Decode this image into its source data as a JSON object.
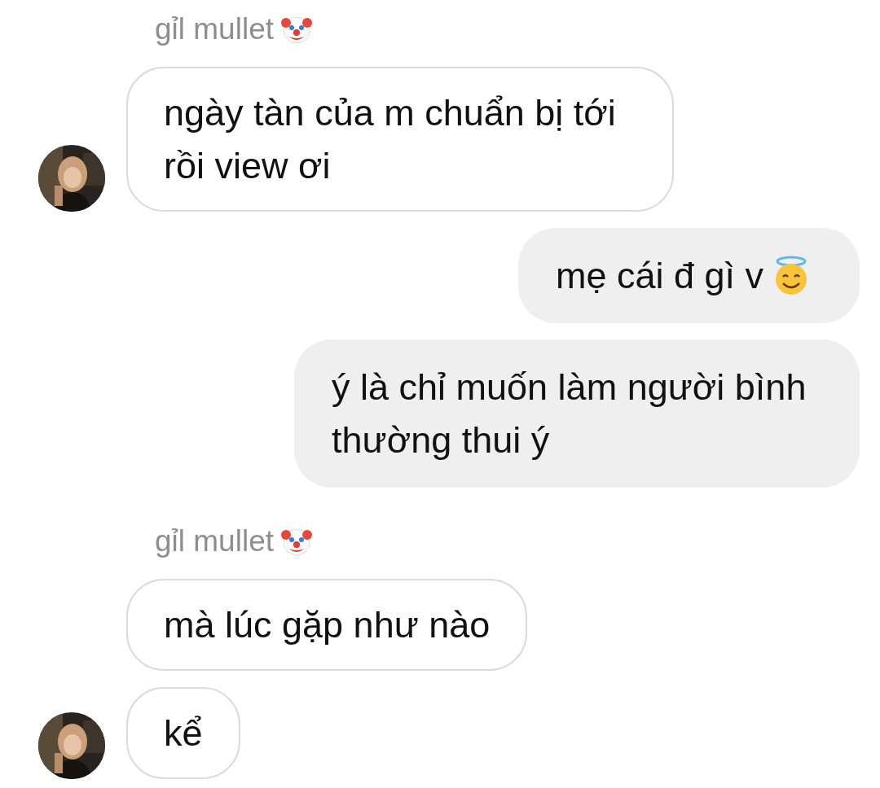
{
  "messages": [
    {
      "kind": "sender_name",
      "text": "gỉl mullet"
    },
    {
      "kind": "received",
      "text": "ngày tàn của m chuẩn bị tới rồi view ơi",
      "show_avatar": true
    },
    {
      "kind": "sent",
      "text": "mẹ cái đ gì v",
      "has_emoji": true
    },
    {
      "kind": "sent",
      "text": "ý là chỉ muốn làm người bình thường thui ý",
      "has_emoji": false
    },
    {
      "kind": "sender_name",
      "text": "gỉl mullet"
    },
    {
      "kind": "received",
      "text": "mà lúc gặp như nào",
      "show_avatar": false
    },
    {
      "kind": "received",
      "text": "kể",
      "show_avatar": true
    }
  ]
}
